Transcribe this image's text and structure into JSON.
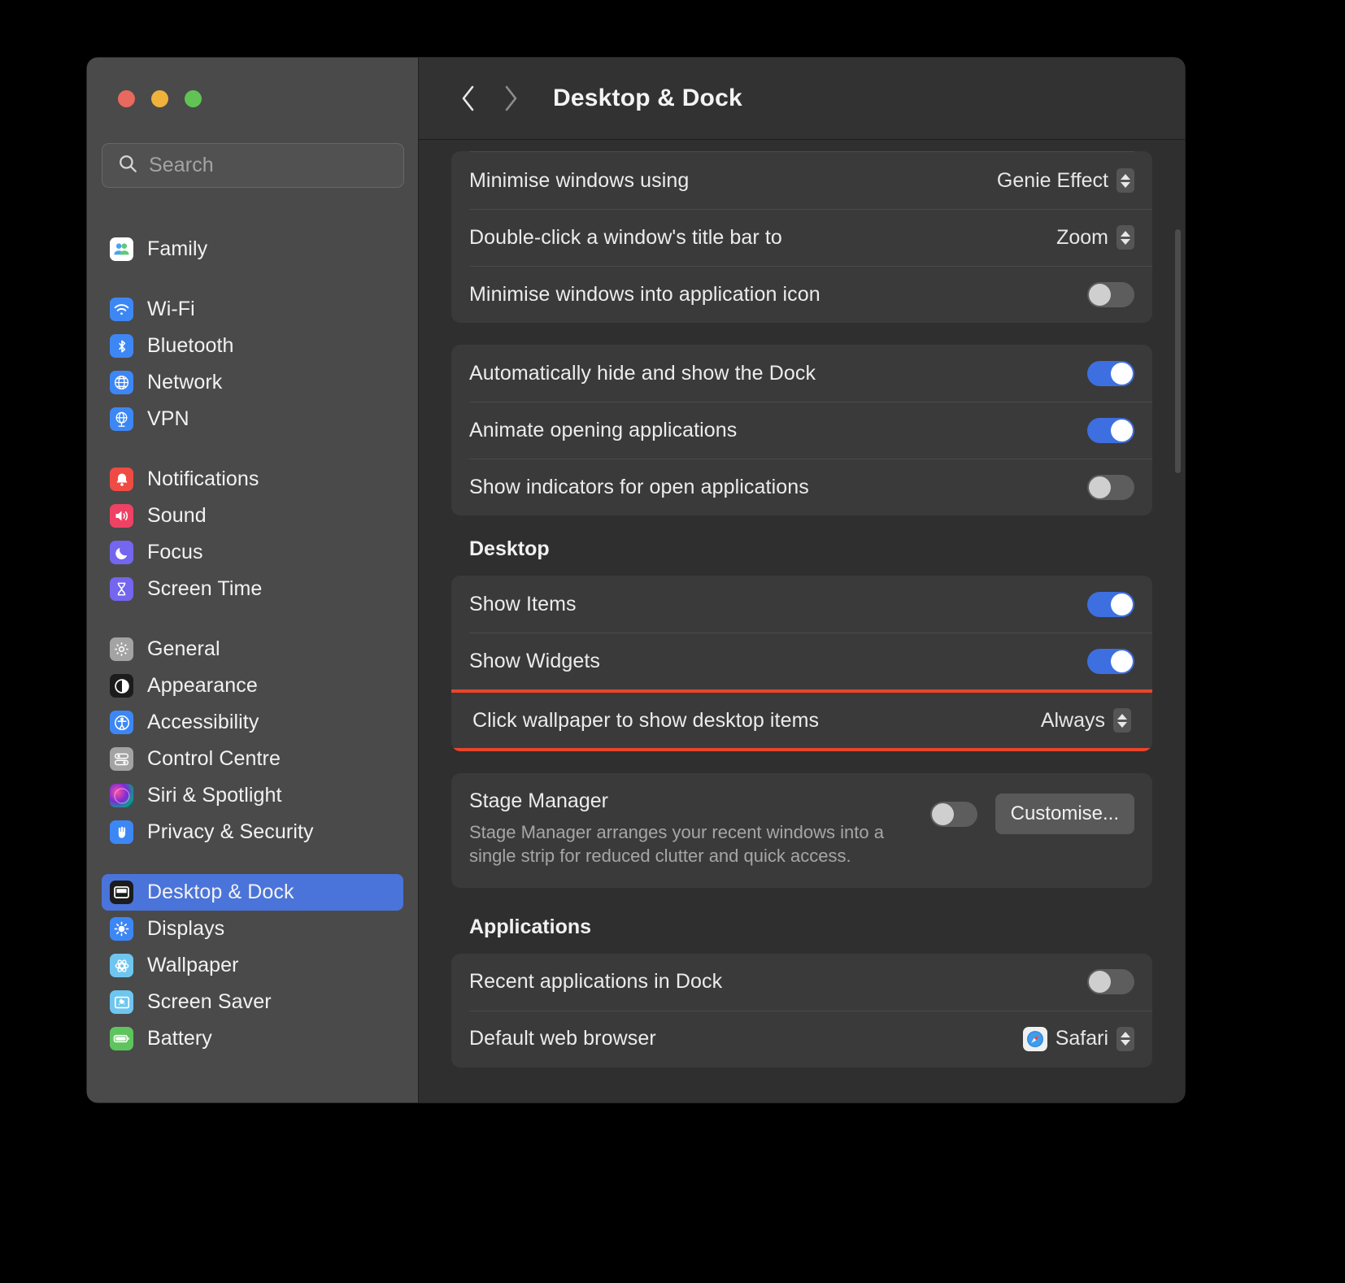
{
  "window": {
    "title": "Desktop & Dock",
    "traffic_lights": [
      "close-button",
      "minimise-button",
      "zoom-button"
    ],
    "accent_color": "#4a74da",
    "highlight_color": "#e8452c"
  },
  "sidebar": {
    "search": {
      "placeholder": "Search"
    },
    "groups": [
      {
        "items": [
          {
            "label": "Family",
            "icon": "family-icon"
          }
        ]
      },
      {
        "items": [
          {
            "label": "Wi-Fi",
            "icon": "wifi-icon"
          },
          {
            "label": "Bluetooth",
            "icon": "bluetooth-icon"
          },
          {
            "label": "Network",
            "icon": "network-icon"
          },
          {
            "label": "VPN",
            "icon": "vpn-icon"
          }
        ]
      },
      {
        "items": [
          {
            "label": "Notifications",
            "icon": "notifications-icon"
          },
          {
            "label": "Sound",
            "icon": "sound-icon"
          },
          {
            "label": "Focus",
            "icon": "focus-icon"
          },
          {
            "label": "Screen Time",
            "icon": "screen-time-icon"
          }
        ]
      },
      {
        "items": [
          {
            "label": "General",
            "icon": "general-icon"
          },
          {
            "label": "Appearance",
            "icon": "appearance-icon"
          },
          {
            "label": "Accessibility",
            "icon": "accessibility-icon"
          },
          {
            "label": "Control Centre",
            "icon": "control-centre-icon"
          },
          {
            "label": "Siri & Spotlight",
            "icon": "siri-icon"
          },
          {
            "label": "Privacy & Security",
            "icon": "privacy-icon"
          }
        ]
      },
      {
        "items": [
          {
            "label": "Desktop & Dock",
            "icon": "desktop-dock-icon",
            "selected": true
          },
          {
            "label": "Displays",
            "icon": "displays-icon"
          },
          {
            "label": "Wallpaper",
            "icon": "wallpaper-icon"
          },
          {
            "label": "Screen Saver",
            "icon": "screen-saver-icon"
          },
          {
            "label": "Battery",
            "icon": "battery-icon"
          }
        ]
      }
    ]
  },
  "main": {
    "back_icon": "chevron-left-icon",
    "forward_icon": "chevron-right-icon",
    "dock_group": [
      {
        "label": "Minimise windows using",
        "control": "popup",
        "value": "Genie Effect"
      },
      {
        "label": "Double-click a window's title bar to",
        "control": "popup",
        "value": "Zoom"
      },
      {
        "label": "Minimise windows into application icon",
        "control": "toggle",
        "value": "off"
      }
    ],
    "dock_group_2": [
      {
        "label": "Automatically hide and show the Dock",
        "control": "toggle",
        "value": "on"
      },
      {
        "label": "Animate opening applications",
        "control": "toggle",
        "value": "on"
      },
      {
        "label": "Show indicators for open applications",
        "control": "toggle",
        "value": "off"
      }
    ],
    "desktop_section": {
      "title": "Desktop",
      "rows": [
        {
          "label": "Show Items",
          "control": "toggle",
          "value": "on"
        },
        {
          "label": "Show Widgets",
          "control": "toggle",
          "value": "on"
        },
        {
          "label": "Click wallpaper to show desktop items",
          "control": "popup",
          "value": "Always",
          "highlighted": true
        }
      ],
      "stage_manager": {
        "title": "Stage Manager",
        "description": "Stage Manager arranges your recent windows into a single strip for reduced clutter and quick access.",
        "toggle": "off",
        "button": "Customise..."
      }
    },
    "applications_section": {
      "title": "Applications",
      "rows": [
        {
          "label": "Recent applications in Dock",
          "control": "toggle",
          "value": "off"
        },
        {
          "label": "Default web browser",
          "control": "popup",
          "value": "Safari",
          "icon": "safari-icon"
        }
      ]
    }
  }
}
